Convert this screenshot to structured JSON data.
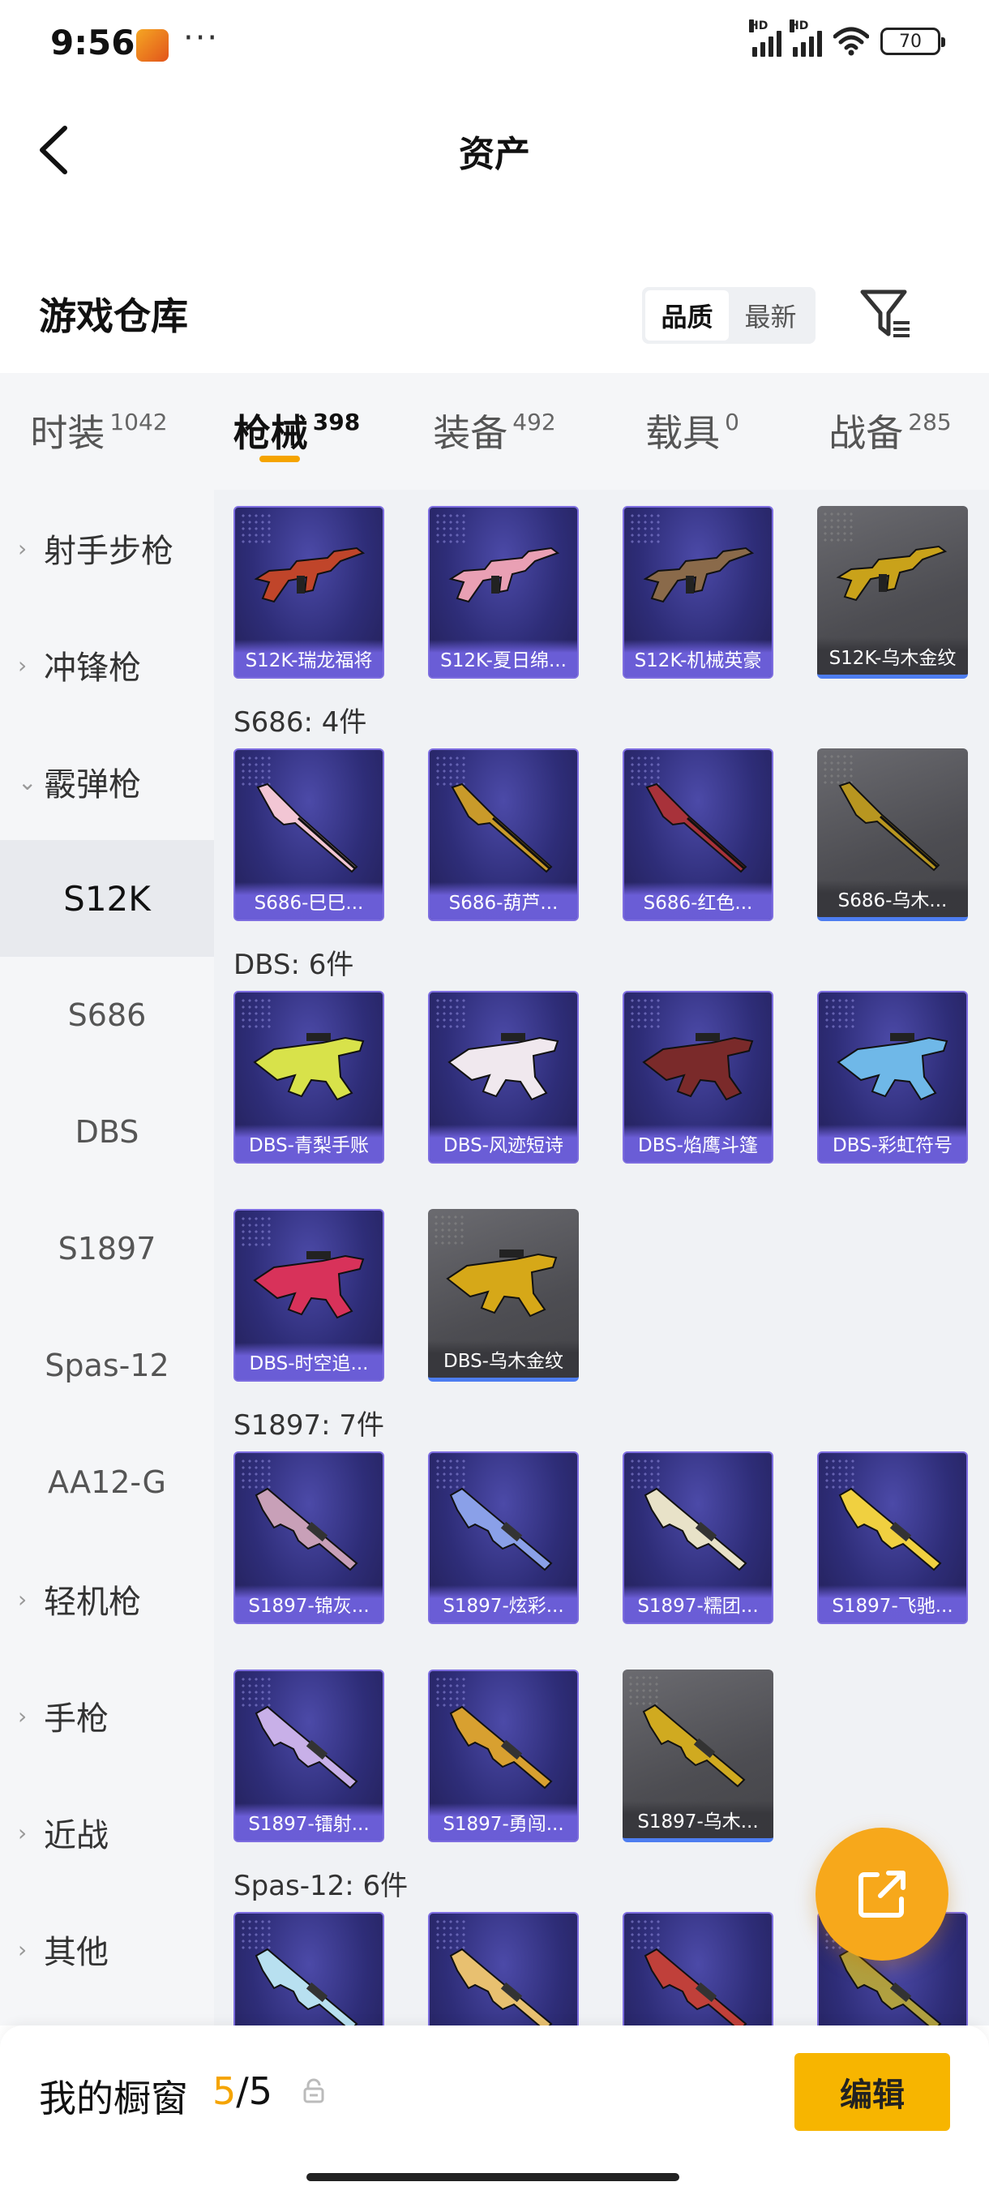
{
  "status_bar": {
    "time": "9:56",
    "more": "···",
    "battery": "70",
    "hd1": "HD",
    "hd2": "HD"
  },
  "header": {
    "title": "资产"
  },
  "section": {
    "title": "游戏仓库",
    "sort_options": [
      "品质",
      "最新"
    ],
    "selected_sort": "品质"
  },
  "tabs": [
    {
      "label": "时装",
      "count": "1042"
    },
    {
      "label": "枪械",
      "count": "398"
    },
    {
      "label": "装备",
      "count": "492"
    },
    {
      "label": "载具",
      "count": "0"
    },
    {
      "label": "战备",
      "count": "285"
    }
  ],
  "active_tab": "枪械",
  "sidebar": {
    "categories_top": [
      {
        "label": "射手步枪",
        "chevron": "›"
      },
      {
        "label": "冲锋枪",
        "chevron": "›"
      },
      {
        "label": "霰弹枪",
        "chevron": "⌄"
      }
    ],
    "subitems": [
      "S12K",
      "S686",
      "DBS",
      "S1897",
      "Spas-12",
      "AA12-G"
    ],
    "selected_subitem": "S12K",
    "categories_bottom": [
      {
        "label": "轻机枪",
        "chevron": "›"
      },
      {
        "label": "手枪",
        "chevron": "›"
      },
      {
        "label": "近战",
        "chevron": "›"
      },
      {
        "label": "其他",
        "chevron": "›"
      }
    ]
  },
  "groups": [
    {
      "header": "",
      "items": [
        {
          "name": "S12K-瑞龙福将",
          "style": "purple",
          "gun": "rifle",
          "color": "#c0452a"
        },
        {
          "name": "S12K-夏日绵...",
          "style": "purple",
          "gun": "rifle",
          "color": "#e9a0b4"
        },
        {
          "name": "S12K-机械英豪",
          "style": "purple",
          "gun": "rifle",
          "color": "#8a6a4a"
        },
        {
          "name": "S12K-乌木金纹",
          "style": "gray",
          "gun": "rifle",
          "color": "#c9a21a"
        }
      ]
    },
    {
      "header": "S686: 4件",
      "items": [
        {
          "name": "S686-巳巳...",
          "style": "purple",
          "gun": "shotgun",
          "color": "#f2c6d4"
        },
        {
          "name": "S686-葫芦...",
          "style": "purple",
          "gun": "shotgun",
          "color": "#c99a2a"
        },
        {
          "name": "S686-红色...",
          "style": "purple",
          "gun": "shotgun",
          "color": "#a8323a"
        },
        {
          "name": "S686-乌木...",
          "style": "gray",
          "gun": "shotgun",
          "color": "#b89620"
        }
      ]
    },
    {
      "header": "DBS: 6件",
      "items": [
        {
          "name": "DBS-青梨手账",
          "style": "purple",
          "gun": "bullpup",
          "color": "#d8e24a"
        },
        {
          "name": "DBS-风迹短诗",
          "style": "purple",
          "gun": "bullpup",
          "color": "#f0e8ee"
        },
        {
          "name": "DBS-焰鹰斗篷",
          "style": "purple",
          "gun": "bullpup",
          "color": "#7a2a2a"
        },
        {
          "name": "DBS-彩虹符号",
          "style": "purple",
          "gun": "bullpup",
          "color": "#6fb8e8"
        },
        {
          "name": "DBS-时空追...",
          "style": "purple",
          "gun": "bullpup",
          "color": "#d8325a"
        },
        {
          "name": "DBS-乌木金纹",
          "style": "gray",
          "gun": "bullpup",
          "color": "#d6a818"
        }
      ]
    },
    {
      "header": "S1897: 7件",
      "items": [
        {
          "name": "S1897-锦灰...",
          "style": "purple",
          "gun": "pump",
          "color": "#c8a0b8"
        },
        {
          "name": "S1897-炫彩...",
          "style": "purple",
          "gun": "pump",
          "color": "#8aa0e8"
        },
        {
          "name": "S1897-糯团...",
          "style": "purple",
          "gun": "pump",
          "color": "#e8e2c8"
        },
        {
          "name": "S1897-飞驰...",
          "style": "purple",
          "gun": "pump",
          "color": "#f0d040"
        },
        {
          "name": "S1897-镭射...",
          "style": "purple",
          "gun": "pump",
          "color": "#c8b0e8"
        },
        {
          "name": "S1897-勇闯...",
          "style": "purple",
          "gun": "pump",
          "color": "#d8a030"
        },
        {
          "name": "S1897-乌木...",
          "style": "gray",
          "gun": "pump",
          "color": "#d0aa20"
        }
      ]
    },
    {
      "header": "Spas-12: 6件",
      "items": [
        {
          "name": "",
          "style": "purple",
          "gun": "pump",
          "color": "#b8e0f0"
        },
        {
          "name": "",
          "style": "purple",
          "gun": "pump",
          "color": "#e8c070"
        },
        {
          "name": "",
          "style": "purple",
          "gun": "pump",
          "color": "#c0403a"
        },
        {
          "name": "",
          "style": "purple",
          "gun": "pump",
          "color": "#b0a040"
        }
      ]
    }
  ],
  "bottom_bar": {
    "label": "我的橱窗",
    "current": "5",
    "total": "/5",
    "edit_label": "编辑"
  },
  "colors": {
    "accent": "#f5a400",
    "card_border": "#7d6de0",
    "gray_card_underline": "#4d7df0"
  }
}
